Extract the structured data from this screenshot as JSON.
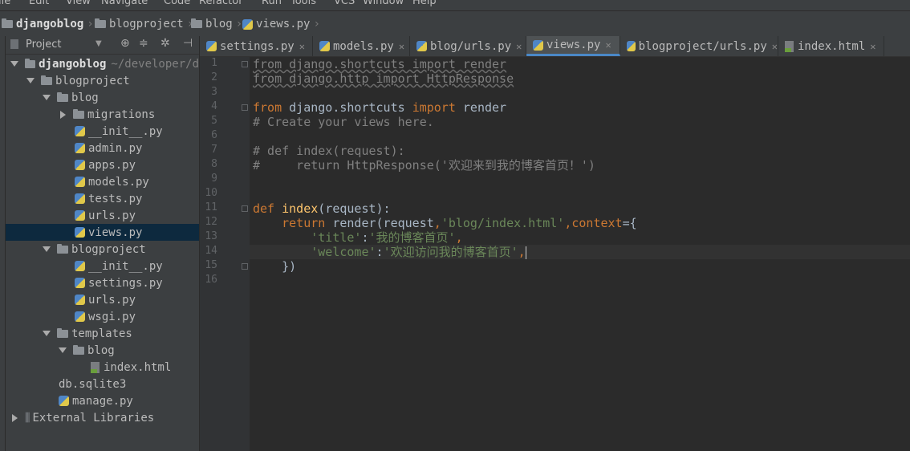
{
  "menu": {
    "items": [
      "ile",
      "Edit",
      "View",
      "Navigate",
      "Code",
      "Refactor",
      "Run",
      "Tools",
      "VCS",
      "Window",
      "Help"
    ]
  },
  "breadcrumb": {
    "items": [
      "djangoblog",
      "blogproject",
      "blog",
      "views.py"
    ]
  },
  "project_panel": {
    "header_label": "Project",
    "tree": [
      {
        "label": "djangoblog",
        "extra": "~/developer/d",
        "type": "folder",
        "expanded": true,
        "depth": 0
      },
      {
        "label": "blogproject",
        "type": "folder",
        "expanded": true,
        "depth": 1
      },
      {
        "label": "blog",
        "type": "folder",
        "expanded": true,
        "depth": 2
      },
      {
        "label": "migrations",
        "type": "folder",
        "expanded": false,
        "depth": 3
      },
      {
        "label": "__init__.py",
        "type": "py",
        "depth": 4
      },
      {
        "label": "admin.py",
        "type": "py",
        "depth": 4
      },
      {
        "label": "apps.py",
        "type": "py",
        "depth": 4
      },
      {
        "label": "models.py",
        "type": "py",
        "depth": 4
      },
      {
        "label": "tests.py",
        "type": "py",
        "depth": 4
      },
      {
        "label": "urls.py",
        "type": "py",
        "depth": 4
      },
      {
        "label": "views.py",
        "type": "py",
        "depth": 4,
        "selected": true
      },
      {
        "label": "blogproject",
        "type": "folder",
        "expanded": true,
        "depth": 2
      },
      {
        "label": "__init__.py",
        "type": "py",
        "depth": 4
      },
      {
        "label": "settings.py",
        "type": "py",
        "depth": 4
      },
      {
        "label": "urls.py",
        "type": "py",
        "depth": 4
      },
      {
        "label": "wsgi.py",
        "type": "py",
        "depth": 4
      },
      {
        "label": "templates",
        "type": "folder",
        "expanded": true,
        "depth": 2
      },
      {
        "label": "blog",
        "type": "folder",
        "expanded": true,
        "depth": 3
      },
      {
        "label": "index.html",
        "type": "html",
        "depth": 5
      },
      {
        "label": "db.sqlite3",
        "type": "db",
        "depth": 3
      },
      {
        "label": "manage.py",
        "type": "py",
        "depth": 3
      },
      {
        "label": "External Libraries",
        "type": "lib",
        "expanded": false,
        "depth": 0
      }
    ]
  },
  "tabs": [
    {
      "label": "settings.py",
      "icon": "python-file-icon"
    },
    {
      "label": "models.py",
      "icon": "python-file-icon"
    },
    {
      "label": "blog/urls.py",
      "icon": "python-file-icon"
    },
    {
      "label": "views.py",
      "icon": "python-file-icon",
      "active": true
    },
    {
      "label": "blogproject/urls.py",
      "icon": "python-file-icon"
    },
    {
      "label": "index.html",
      "icon": "html-file-icon"
    }
  ],
  "editor": {
    "line_numbers": [
      "1",
      "2",
      "3",
      "4",
      "5",
      "6",
      "7",
      "8",
      "9",
      "10",
      "11",
      "12",
      "13",
      "14",
      "15",
      "16"
    ],
    "current_line": 14,
    "lines": [
      [
        {
          "t": "from django.shortcuts import render",
          "c": "unused"
        }
      ],
      [
        {
          "t": "from django.http import HttpResponse",
          "c": "unused"
        }
      ],
      [],
      [
        {
          "t": "from",
          "c": "kw"
        },
        {
          "t": " django.shortcuts ",
          "c": "plain"
        },
        {
          "t": "import",
          "c": "kw"
        },
        {
          "t": " render",
          "c": "plain"
        }
      ],
      [
        {
          "t": "# Create your views here.",
          "c": "cmt"
        }
      ],
      [],
      [
        {
          "t": "# def index(request):",
          "c": "cmt"
        }
      ],
      [
        {
          "t": "#     return HttpResponse('欢迎来到我的博客首页！')",
          "c": "cmt"
        }
      ],
      [],
      [],
      [
        {
          "t": "def",
          "c": "kw"
        },
        {
          "t": " ",
          "c": "plain"
        },
        {
          "t": "index",
          "c": "fn"
        },
        {
          "t": "(request):",
          "c": "plain"
        }
      ],
      [
        {
          "t": "    ",
          "c": "plain"
        },
        {
          "t": "return",
          "c": "kw"
        },
        {
          "t": " render(request",
          "c": "plain"
        },
        {
          "t": ",",
          "c": "kw"
        },
        {
          "t": "'blog/index.html'",
          "c": "str"
        },
        {
          "t": ",",
          "c": "kw"
        },
        {
          "t": "context",
          "c": "kw"
        },
        {
          "t": "={",
          "c": "plain"
        }
      ],
      [
        {
          "t": "        ",
          "c": "plain"
        },
        {
          "t": "'title'",
          "c": "str"
        },
        {
          "t": ":",
          "c": "plain"
        },
        {
          "t": "'我的博客首页'",
          "c": "str"
        },
        {
          "t": ",",
          "c": "kw"
        }
      ],
      [
        {
          "t": "        ",
          "c": "plain"
        },
        {
          "t": "'welcome'",
          "c": "str"
        },
        {
          "t": ":",
          "c": "plain"
        },
        {
          "t": "'欢迎访问我的博客首页'",
          "c": "str"
        },
        {
          "t": ",",
          "c": "kw"
        }
      ],
      [
        {
          "t": "    })",
          "c": "plain"
        }
      ],
      []
    ]
  }
}
